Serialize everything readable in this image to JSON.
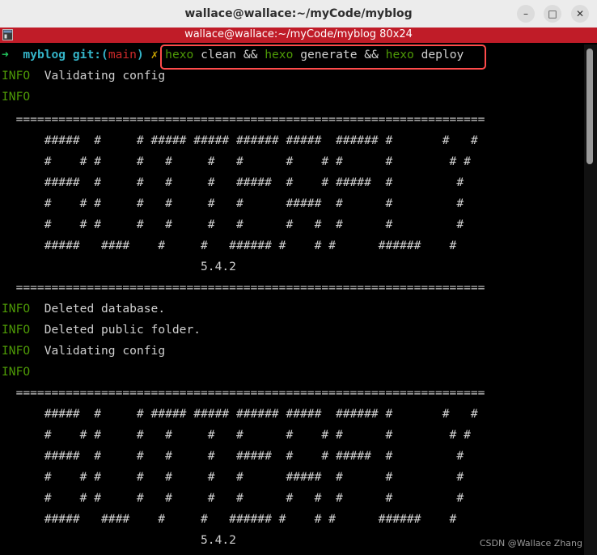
{
  "window": {
    "title": "wallace@wallace:~/myCode/myblog",
    "buttons": {
      "minimize": "–",
      "maximize": "□",
      "close": "✕"
    }
  },
  "tab": {
    "title": "wallace@wallace:~/myCode/myblog 80x24"
  },
  "prompt": {
    "arrow": "➜",
    "dir": "myblog",
    "git_label": "git:(",
    "branch": "main",
    "git_close": ")",
    "marker": "✗",
    "command_parts": [
      "hexo",
      "clean",
      "&&",
      "hexo",
      "generate",
      "&&",
      "hexo",
      "deploy"
    ]
  },
  "output": {
    "info_label": "INFO",
    "msg_validating": "Validating config",
    "msg_deleted_db": "Deleted database.",
    "msg_deleted_public": "Deleted public folder.",
    "banner_rule": "  ==================================================================",
    "banner_art": [
      "      #####  #     # ##### ##### ###### #####  ###### #       #   #",
      "      #    # #     #   #     #   #      #    # #      #        # #",
      "      #####  #     #   #     #   #####  #    # #####  #         #",
      "      #    # #     #   #     #   #      #####  #      #         #",
      "      #    # #     #   #     #   #      #   #  #      #         #",
      "      #####   ####    #     #   ###### #    # #      ######    #"
    ],
    "version": "                            5.4.2"
  },
  "watermark": "CSDN @Wallace Zhang"
}
